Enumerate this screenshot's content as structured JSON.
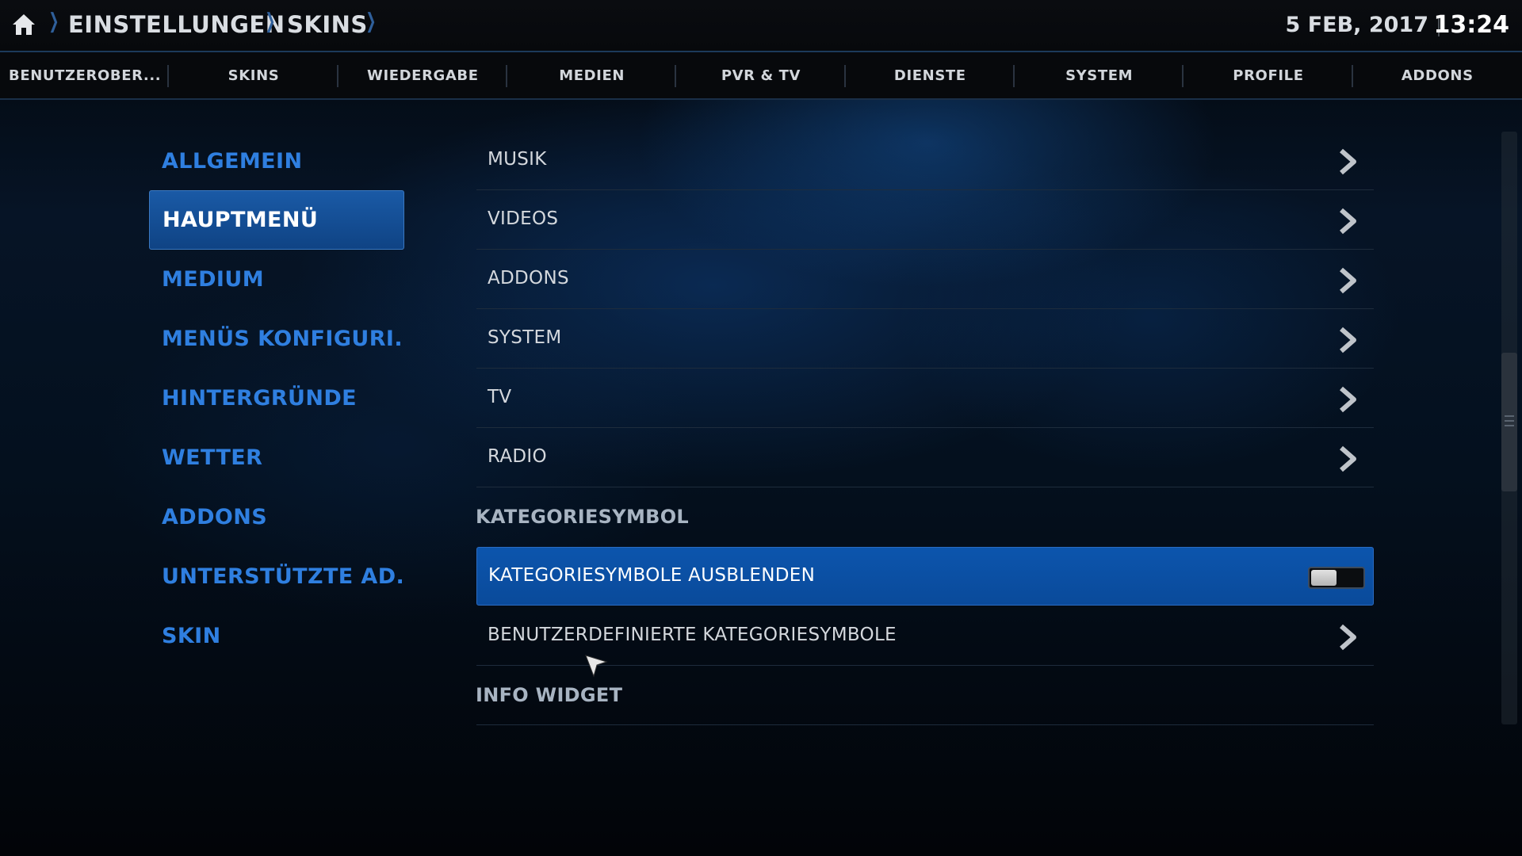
{
  "header": {
    "breadcrumb": [
      "EINSTELLUNGEN",
      "SKINS"
    ],
    "date": "5 FEB, 2017",
    "time": "13:24"
  },
  "tabs": [
    "BENUTZEROBER...",
    "SKINS",
    "WIEDERGABE",
    "MEDIEN",
    "PVR & TV",
    "DIENSTE",
    "SYSTEM",
    "PROFILE",
    "ADDONS"
  ],
  "nav": {
    "items": [
      "ALLGEMEIN",
      "HAUPTMENÜ",
      "MEDIUM",
      "MENÜS KONFIGURI...",
      "HINTERGRÜNDE",
      "WETTER",
      "ADDONS",
      "UNTERSTÜTZTE AD...",
      "SKIN"
    ],
    "selected": "HAUPTMENÜ"
  },
  "settings": {
    "menu_rows": [
      "MUSIK",
      "VIDEOS",
      "ADDONS",
      "SYSTEM",
      "TV",
      "RADIO"
    ],
    "category_header": "KATEGORIESYMBOL",
    "hide_icons_label": "KATEGORIESYMBOLE AUSBLENDEN",
    "hide_icons_enabled": false,
    "custom_icons_label": "BENUTZERDEFINIERTE KATEGORIESYMBOLE",
    "info_widget_header": "INFO WIDGET"
  },
  "icons": {
    "home": "home-icon",
    "breadcrumb_separator": "chevron-right-icon",
    "row_arrow": "chevron-right-icon",
    "pointer": "mouse-pointer-icon"
  },
  "colors": {
    "accent": "#2f7fe0",
    "selected_bg": "#0c55ad",
    "text": "#d4d8dd"
  }
}
